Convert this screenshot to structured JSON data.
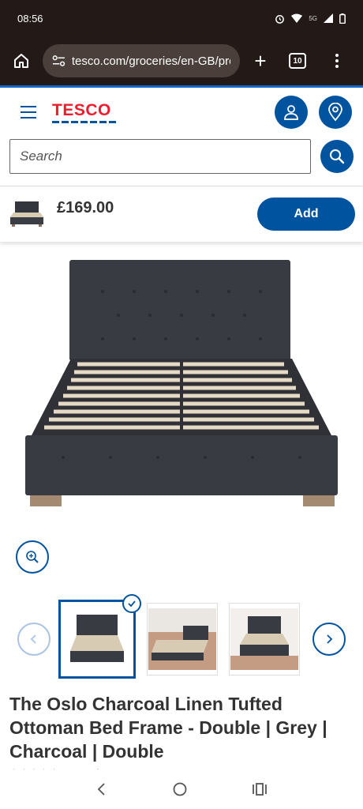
{
  "status_bar": {
    "time": "08:56",
    "network": "5G"
  },
  "browser": {
    "url": "tesco.com/groceries/en-GB/proc",
    "tab_count": "10"
  },
  "header": {
    "logo_text": "TESCO"
  },
  "search": {
    "placeholder": "Search"
  },
  "sticky_bar": {
    "price": "£169.00",
    "add_label": "Add"
  },
  "product": {
    "title": "The Oslo Charcoal Linen Tufted Ottoman Bed Frame - Double | Grey | Charcoal | Double",
    "ratings_text": "No ratings yet",
    "stars": "☆☆☆☆☆"
  },
  "colors": {
    "brand_blue": "#00539f",
    "brand_red": "#ee1c2e",
    "browser_bg": "#231a17"
  }
}
